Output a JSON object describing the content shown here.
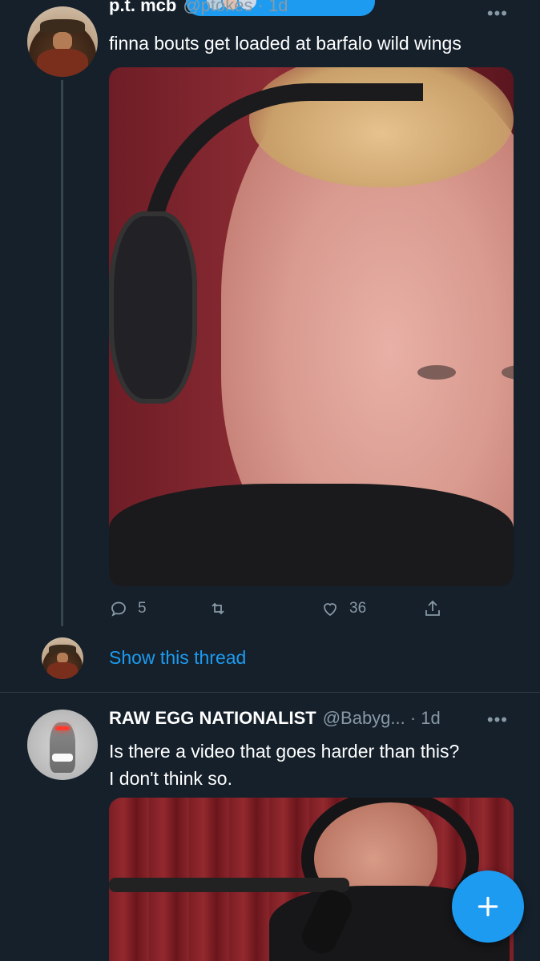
{
  "tweet1": {
    "author_name": "p.t. mcb",
    "author_handle": "@ptokes · 1d",
    "text": "finna bouts get loaded at barfalo wild wings",
    "stats": {
      "replies": "5",
      "retweets": "",
      "likes": "36"
    },
    "show_thread_label": "Show this thread"
  },
  "tweet2": {
    "author_name": "RAW EGG NATIONALIST",
    "author_handle": "@Babyg... · 1d",
    "text_line1": "Is there a video that goes harder than this?",
    "text_line2": "I don't think so."
  },
  "more_icon": "•••",
  "colors": {
    "background": "#15202b",
    "accent": "#1d9bf0",
    "secondary_text": "#8899a6"
  },
  "icons": [
    "reply-icon",
    "retweet-icon",
    "like-icon",
    "share-icon",
    "compose-icon",
    "more-icon"
  ]
}
